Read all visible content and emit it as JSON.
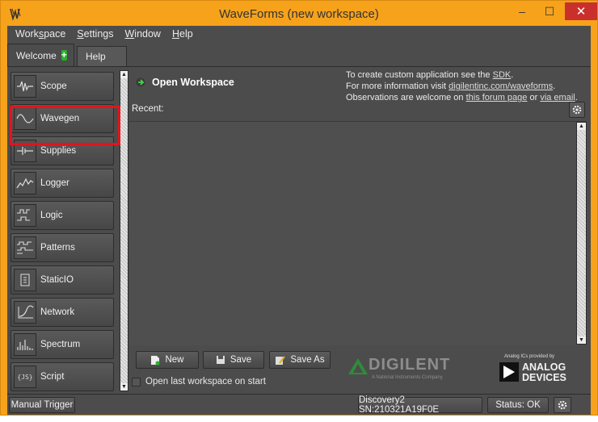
{
  "window": {
    "title": "WaveForms  (new workspace)",
    "minimize_glyph": "–",
    "maximize_glyph": "☐",
    "close_glyph": "✕"
  },
  "menu": {
    "items": [
      {
        "pre": "Work",
        "u": "s",
        "post": "pace"
      },
      {
        "pre": "",
        "u": "S",
        "post": "ettings"
      },
      {
        "pre": "",
        "u": "W",
        "post": "indow"
      },
      {
        "pre": "",
        "u": "H",
        "post": "elp"
      }
    ]
  },
  "tabs": {
    "welcome": "Welcome",
    "help": "Help"
  },
  "instruments": [
    {
      "label": "Scope",
      "icon": "scope-icon"
    },
    {
      "label": "Wavegen",
      "icon": "sine-wave-icon"
    },
    {
      "label": "Supplies",
      "icon": "power-supply-icon"
    },
    {
      "label": "Logger",
      "icon": "logger-icon"
    },
    {
      "label": "Logic",
      "icon": "logic-analyzer-icon"
    },
    {
      "label": "Patterns",
      "icon": "patterns-icon"
    },
    {
      "label": "StaticIO",
      "icon": "static-io-icon"
    },
    {
      "label": "Network",
      "icon": "network-analyzer-icon"
    },
    {
      "label": "Spectrum",
      "icon": "spectrum-icon"
    },
    {
      "label": "Script",
      "icon": "script-icon"
    }
  ],
  "welcome": {
    "open_workspace": "Open Workspace",
    "info_line1_pre": "To create custom application see the ",
    "info_line1_link": "SDK",
    "info_line1_post": ".",
    "info_line2_pre": "For more information visit ",
    "info_line2_link": "digilentinc.com/waveforms",
    "info_line2_post": ".",
    "info_line3_pre": "Observations are welcome on ",
    "info_line3_link1": "this forum page",
    "info_line3_mid": " or ",
    "info_line3_link2": "via email",
    "info_line3_post": ".",
    "recent_label": "Recent:",
    "new_label": "New",
    "save_label": "Save",
    "save_as_label": "Save As",
    "open_last_label": "Open last workspace on start",
    "digilent_word": "DIGILENT",
    "digilent_sub": "A National Instruments Company",
    "adi_small": "Analog ICs provided by",
    "adi_line1": "ANALOG",
    "adi_line2": "DEVICES"
  },
  "status": {
    "manual_trigger": "Manual Trigger",
    "device": "Discovery2 SN:210321A19F0E",
    "status": "Status: OK"
  },
  "colors": {
    "frame": "#f6a21b",
    "panel": "#4c4c4c",
    "highlight": "#e3141a",
    "accent_green": "#27b327"
  }
}
